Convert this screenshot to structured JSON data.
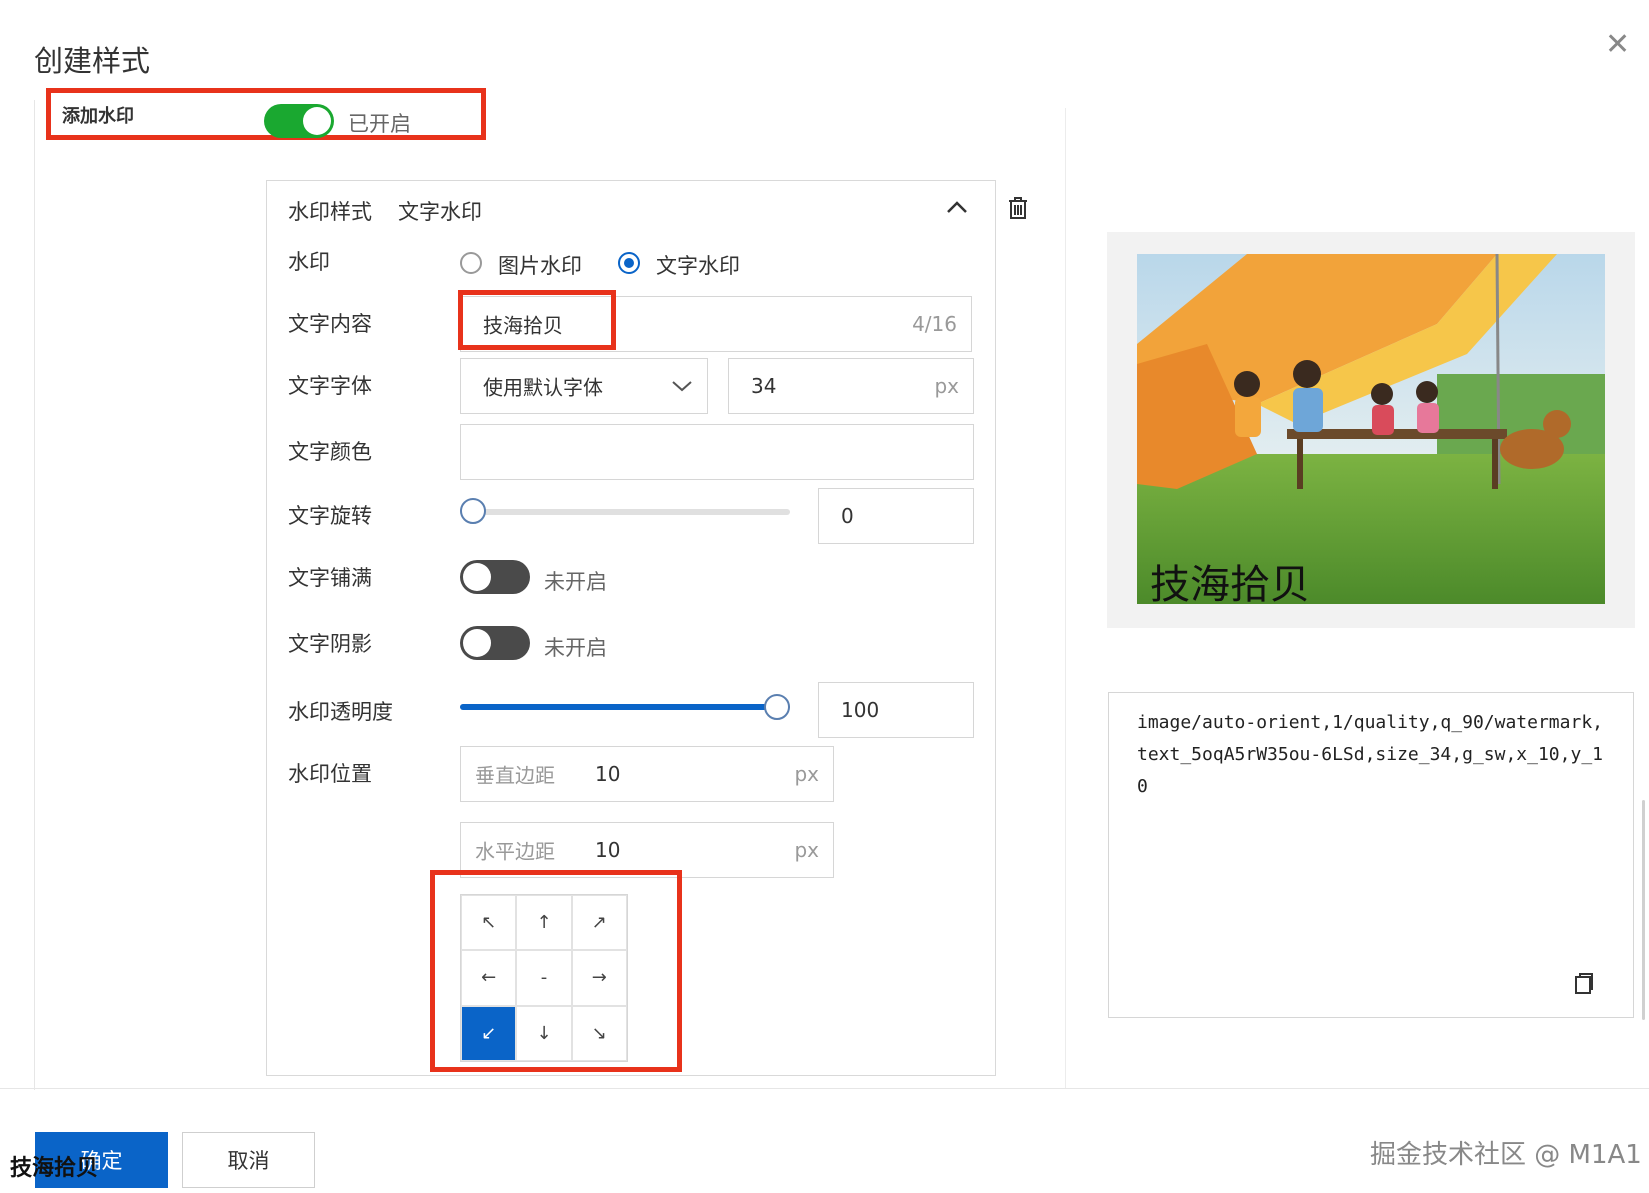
{
  "dialog": {
    "title": "创建样式",
    "close_icon": "close-icon"
  },
  "watermark_toggle": {
    "label": "添加水印",
    "status": "已开启",
    "enabled": true
  },
  "panel": {
    "header_label": "水印样式",
    "header_value": "文字水印",
    "collapse_icon": "chevron-up-icon",
    "delete_icon": "trash-icon",
    "type": {
      "label": "水印",
      "options": [
        "图片水印",
        "文字水印"
      ],
      "selected": "文字水印"
    },
    "text_content": {
      "label": "文字内容",
      "value": "技海拾贝",
      "counter": "4/16"
    },
    "font": {
      "label": "文字字体",
      "selected": "使用默认字体",
      "size": "34",
      "unit": "px"
    },
    "color": {
      "label": "文字颜色",
      "value": ""
    },
    "rotation": {
      "label": "文字旋转",
      "value": "0",
      "slider_fraction": 0
    },
    "tile": {
      "label": "文字铺满",
      "status": "未开启"
    },
    "shadow": {
      "label": "文字阴影",
      "status": "未开启"
    },
    "opacity": {
      "label": "水印透明度",
      "value": "100",
      "slider_fraction": 1
    },
    "position": {
      "label": "水印位置",
      "vertical_label": "垂直边距",
      "vertical_value": "10",
      "horizontal_label": "水平边距",
      "horizontal_value": "10",
      "unit": "px",
      "grid": [
        "↖",
        "↑",
        "↗",
        "←",
        "-",
        "→",
        "↙",
        "↓",
        "↘"
      ],
      "selected_index": 6
    }
  },
  "preview": {
    "watermark_text": "技海拾贝",
    "code": "image/auto-orient,1/quality,q_90/watermark,text_5oqA5rW35ou-6LSd,size_34,g_sw,x_10,y_10",
    "copy_icon": "copy-icon"
  },
  "footer": {
    "confirm": "确定",
    "cancel": "取消",
    "overlay_watermark": "技海拾贝",
    "site_watermark": "掘金技术社区 @ M1A1"
  },
  "colors": {
    "primary": "#0a64c8",
    "switch_on": "#1aa830",
    "switch_off": "#4a4a4a",
    "highlight": "#e8321b"
  }
}
